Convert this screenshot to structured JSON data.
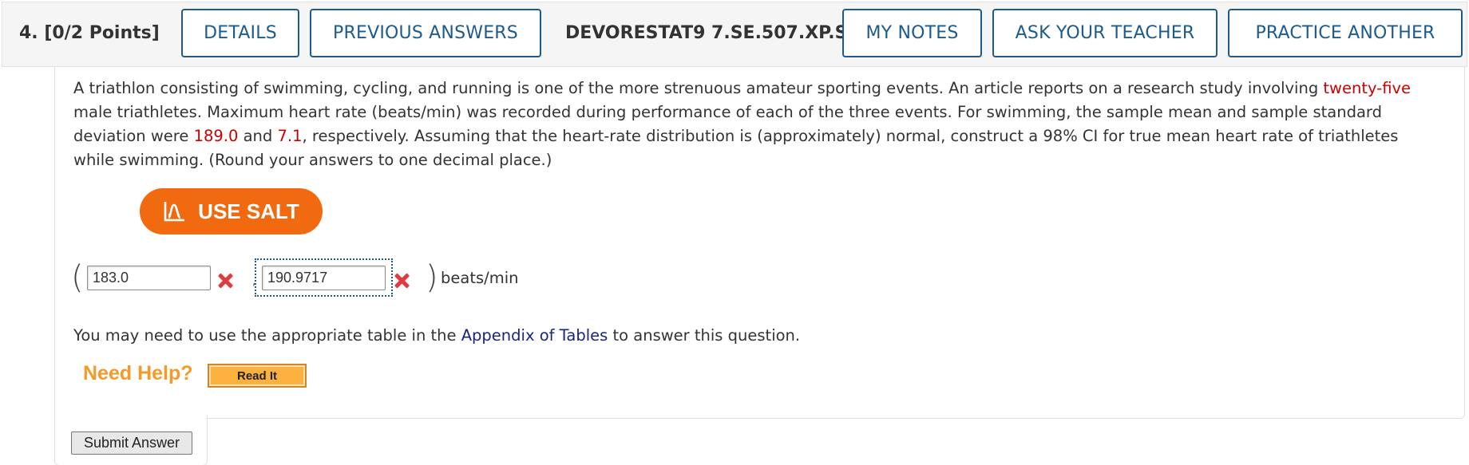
{
  "header": {
    "question_label": "4.  [0/2 Points]",
    "buttons": {
      "details": "DETAILS",
      "previous_answers": "PREVIOUS ANSWERS",
      "my_notes": "MY NOTES",
      "ask_teacher": "ASK YOUR TEACHER",
      "practice_another": "PRACTICE ANOTHER"
    },
    "problem_code": "DEVORESTAT9 7.SE.507.XP.S."
  },
  "question": {
    "text_1": "A triathlon consisting of swimming, cycling, and running is one of the more strenuous amateur sporting events. An article reports on a research study involving ",
    "n_value": "twenty-five",
    "text_2": " male triathletes. Maximum heart rate (beats/min) was recorded during performance of each of the three events. For swimming, the sample mean and sample standard deviation were ",
    "mean_value": "189.0",
    "text_3": " and ",
    "sd_value": "7.1",
    "text_4": ", respectively. Assuming that the heart-rate distribution is (approximately) normal, construct a 98% CI for true mean heart rate of triathletes while swimming. (Round your answers to one decimal place.)"
  },
  "salt_button": {
    "label": "USE SALT",
    "icon": "salt-distribution-icon",
    "color": "#f26a10"
  },
  "answer": {
    "open_paren": "(",
    "lower_value": "183.0",
    "comma": ",",
    "upper_value": "190.9717",
    "close_paren": ")",
    "units": "beats/min",
    "status_icon": "incorrect-x-icon",
    "status_color": "#e0393e"
  },
  "appendix": {
    "text_before": "You may need to use the appropriate table in the ",
    "link": "Appendix of Tables",
    "text_after": " to answer this question."
  },
  "help": {
    "label": "Need Help?",
    "read_it": "Read It"
  },
  "submit": {
    "label": "Submit Answer"
  },
  "colors": {
    "brand_blue": "#1d5b8c",
    "highlight_red": "#cc0000",
    "help_orange": "#f39a2a"
  }
}
